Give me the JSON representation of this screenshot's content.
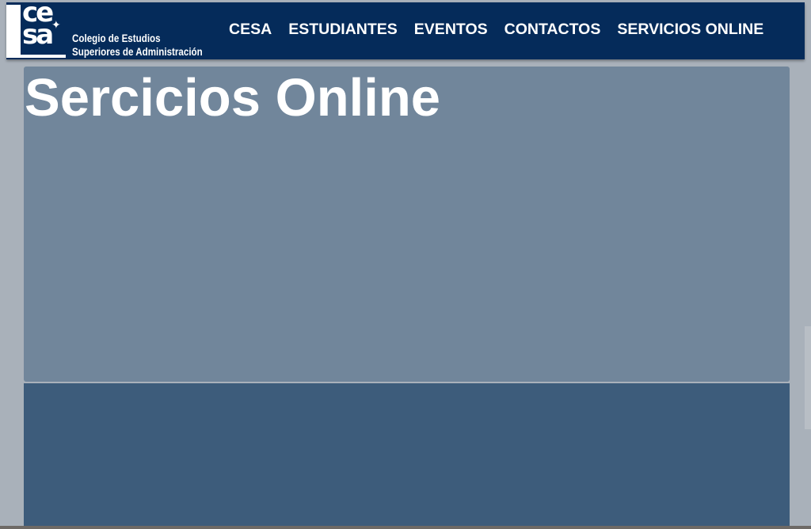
{
  "brand": {
    "logo_line1": "ce",
    "logo_line2": "sa",
    "logo_star": "✦",
    "name_line1": "Colegio de Estudios",
    "name_line2": "Superiores de Administración"
  },
  "nav": {
    "items": [
      {
        "label": "CESA"
      },
      {
        "label": "ESTUDIANTES"
      },
      {
        "label": "EVENTOS"
      },
      {
        "label": "CONTACTOS"
      },
      {
        "label": "SERVICIOS ONLINE"
      }
    ]
  },
  "hero": {
    "title": "Sercicios Online"
  },
  "colors": {
    "navbar": "#052b5a",
    "hero_panel": "#71869b",
    "lower_panel": "#3d5c7b",
    "page_background": "#a9b1ba",
    "text": "#ffffff"
  }
}
